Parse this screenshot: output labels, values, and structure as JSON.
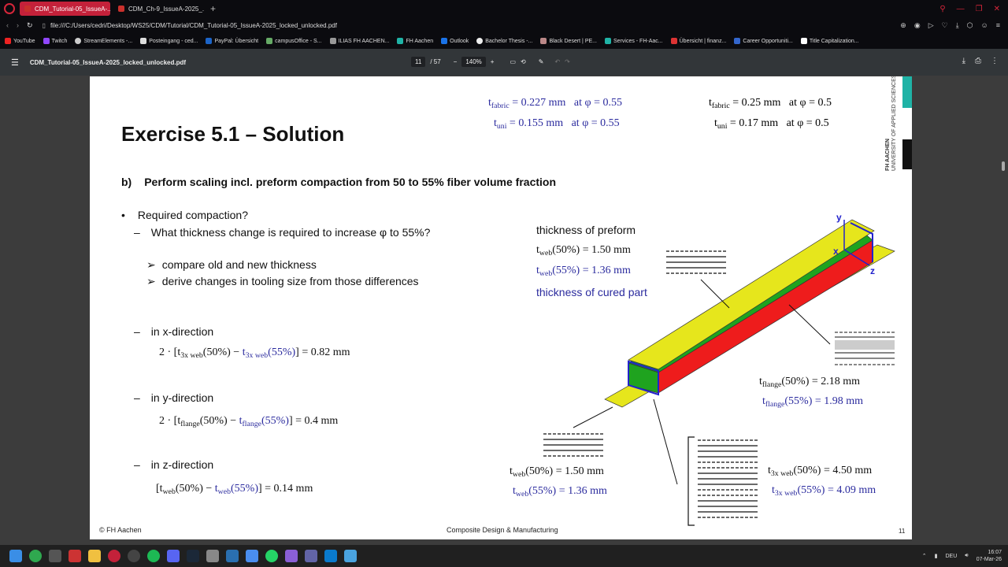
{
  "browser": {
    "tabs": [
      {
        "label": "CDM_Tutorial-05_IssueA-...",
        "active": true
      },
      {
        "label": "CDM_Ch-9_IssueA-2025_...",
        "active": false
      }
    ],
    "url_prefix": "file:///",
    "url": "C:/Users/cedri/Desktop/WS25/CDM/Tutorial/CDM_Tutorial-05_IssueA-2025_locked_unlocked.pdf",
    "bookmarks": [
      "YouTube",
      "Twitch",
      "StreamElements -...",
      "Posteingang - ced...",
      "PayPal: Übersicht",
      "campusOffice - S...",
      "ILIAS FH AACHEN...",
      "FH Aachen",
      "Outlook",
      "Bachelor Thesis -...",
      "Black Desert | PE...",
      "Services - FH-Aac...",
      "Übersicht | finanz...",
      "Career Opportuniti...",
      "Title Capitalization..."
    ]
  },
  "pdf": {
    "filename": "CDM_Tutorial-05_IssueA-2025_locked_unlocked.pdf",
    "page_current": "11",
    "page_total": "/ 57",
    "zoom": "140%"
  },
  "slide": {
    "title": "Exercise 5.1 – Solution",
    "subtitle_letter": "b)",
    "subtitle": "Perform scaling incl. preform compaction from 50 to 55% fiber volume fraction",
    "bullet": "Required compaction?",
    "question": "What thickness change is required to increase φ to 55%?",
    "arrow_items": [
      "compare old and new thickness",
      "derive changes in tooling size from those differences"
    ],
    "x_dir": "in x-direction",
    "y_dir": "in y-direction",
    "z_dir": "in z-direction",
    "eq_x_result": "] = 0.82 mm",
    "eq_y_result": "] = 0.4 mm",
    "eq_z_result": "] = 0.14 mm",
    "t_fabric_55": "= 0.227 mm   at φ = 0.55",
    "t_uni_55": "= 0.155 mm   at φ = 0.55",
    "t_fabric_50": "= 0.25 mm   at φ = 0.5",
    "t_uni_50": "= 0.17 mm   at φ = 0.5",
    "preform_label": "thickness of preform",
    "web50_top": "(50%) = 1.50 mm",
    "web55_top": "(55%) = 1.36 mm",
    "cured_label": "thickness of cured part",
    "flange50": "(50%) = 2.18 mm",
    "flange55": "(55%) = 1.98 mm",
    "web50_bot": "(50%) = 1.50 mm",
    "web55_bot": "(55%) = 1.36 mm",
    "web3x50": "(50%) = 4.50 mm",
    "web3x55": "(55%) = 4.09 mm",
    "axis_x": "x",
    "axis_y": "y",
    "axis_z": "z",
    "footer_left": "© FH Aachen",
    "footer_center": "Composite Design & Manufacturing",
    "footer_page": "11",
    "logo_line1": "FH AACHEN",
    "logo_line2": "UNIVERSITY OF APPLIED SCIENCES"
  },
  "taskbar": {
    "lang": "DEU",
    "time": "16:07",
    "date": "07-Mar-26"
  },
  "colors": {
    "accent_tab": "#c4213a",
    "formula_blue": "#2b2b9e",
    "green": "#1fa31f",
    "red": "#ee1c1c",
    "yellow": "#e6e61c",
    "teal": "#1fb3a6"
  }
}
